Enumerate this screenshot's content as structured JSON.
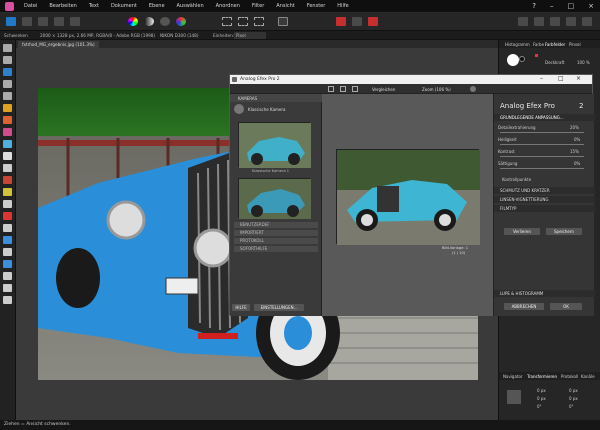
{
  "menubar": {
    "items": [
      "Datei",
      "Bearbeiten",
      "Text",
      "Dokument",
      "Ebene",
      "Auswählen",
      "Anordnen",
      "Filter",
      "Ansicht",
      "Fenster",
      "Hilfe"
    ]
  },
  "context": {
    "label": "Schwenken",
    "info": "2000 × 1328 px, 2.66 MP, RGBA/8 - Adobe RGB (1998)",
    "camera": "NIKON D300 (148)",
    "units_label": "Einheiten:",
    "units_value": "Pixel"
  },
  "document": {
    "tab": "fxtrhod_MG_ergebnis.jpg (101.3%)"
  },
  "right_panel": {
    "tabs": [
      "Histogramm",
      "Farbe",
      "Farbfelder",
      "Pinsel"
    ],
    "opacity_label": "Deckkraft",
    "opacity_value": "100 %",
    "bottom_tabs": [
      "Navigator",
      "Transformieren",
      "Protokoll",
      "Kanäle"
    ],
    "fields": [
      "0 px",
      "0 px",
      "0 px",
      "0 px",
      "0°",
      "0°"
    ]
  },
  "plugin": {
    "title": "Analog Efex Pro 2",
    "compare_label": "Vergleichen",
    "zoom_label": "Zoom (106 %)",
    "left": {
      "header": "KAMERAS",
      "camera": "Klassische Kamera",
      "thumb1_caption": "Klassische Kamera 1",
      "sections": [
        "BENUTZERDEF",
        "IMPORTIERT",
        "PROTOKOLL",
        "SOFORTHILFE"
      ],
      "help_btn": "HILFE",
      "settings_btn": "EINSTELLUNGEN..."
    },
    "preview": {
      "caption1": "Bild-Vorlage: 1",
      "caption2": "(1 / 10)"
    },
    "rightp": {
      "brand": "Analog Efex Pro",
      "version": "2",
      "section_main": "GRUNDLEGENDE ANPASSUNG...",
      "params": [
        {
          "label": "Detailextrahierung",
          "value": "20%"
        },
        {
          "label": "Helligkeit",
          "value": "0%"
        },
        {
          "label": "Kontrast",
          "value": "15%"
        },
        {
          "label": "Sättigung",
          "value": "0%"
        }
      ],
      "sub": "Kontrollpunkte",
      "sections": [
        "SCHMUTZ UND KRATZER",
        "LINSEN-VIGNETTIERUNG",
        "FILMTYP"
      ],
      "btn_left": "Verlieren",
      "btn_right": "Speichern",
      "lupe": "LUPE & HISTOGRAMM",
      "cancel": "ABBRECHEN",
      "ok": "OK"
    }
  },
  "status": {
    "text": "Ziehen = Ansicht schwenken."
  },
  "colors": {
    "accent": "#2e7bd6",
    "car_blue": "#2a8fd8",
    "toolbar": "#262626"
  }
}
